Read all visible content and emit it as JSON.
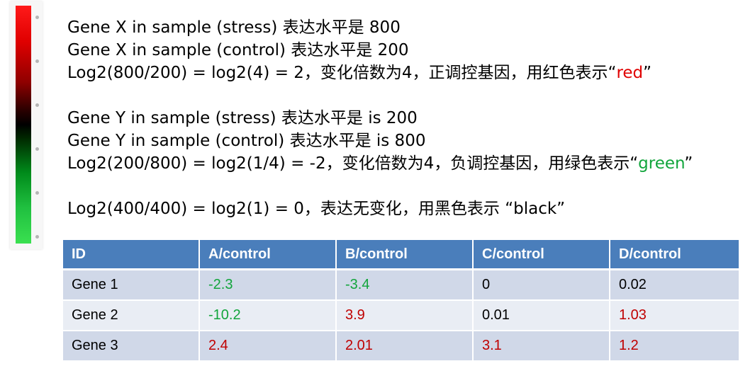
{
  "colors": {
    "up_red": "#e00000",
    "down_green": "#12a53c",
    "table_header": "#4a7ebb",
    "row_odd": "#d0d8e8",
    "row_even": "#e9edf4"
  },
  "scale_bar": {
    "gradient": [
      "red",
      "black",
      "green"
    ]
  },
  "gene_x": {
    "line1": "Gene X in sample (stress)  表达水平是 800",
    "line2": "Gene X in sample (control) 表达水平是 200",
    "line3_prefix": "Log2(800/200) = log2(4) = 2，变化倍数为4，正调控基因，用红色表示“",
    "line3_word": "red",
    "line3_suffix": "”"
  },
  "gene_y": {
    "line1": "Gene Y in sample (stress) 表达水平是 is 200",
    "line2": "Gene Y in sample (control) 表达水平是 is 800",
    "line3_prefix": "Log2(200/800) = log2(1/4) = -2，变化倍数为4，负调控基因，用绿色表示“",
    "line3_word": "green",
    "line3_suffix": "”"
  },
  "no_change": {
    "line": "Log2(400/400) = log2(1) = 0，表达无变化，用黑色表示  “black”"
  },
  "table": {
    "headers": [
      "ID",
      "A/control",
      "B/control",
      "C/control",
      "D/control"
    ],
    "rows": [
      {
        "id": "Gene 1",
        "cells": [
          {
            "value": "-2.3",
            "color": "green"
          },
          {
            "value": "-3.4",
            "color": "green"
          },
          {
            "value": "0",
            "color": "black"
          },
          {
            "value": "0.02",
            "color": "black"
          }
        ]
      },
      {
        "id": "Gene 2",
        "cells": [
          {
            "value": "-10.2",
            "color": "green"
          },
          {
            "value": "3.9",
            "color": "red"
          },
          {
            "value": "0.01",
            "color": "black"
          },
          {
            "value": "1.03",
            "color": "red"
          }
        ]
      },
      {
        "id": "Gene 3",
        "cells": [
          {
            "value": "2.4",
            "color": "red"
          },
          {
            "value": "2.01",
            "color": "red"
          },
          {
            "value": "3.1",
            "color": "red"
          },
          {
            "value": "1.2",
            "color": "red"
          }
        ]
      }
    ]
  }
}
